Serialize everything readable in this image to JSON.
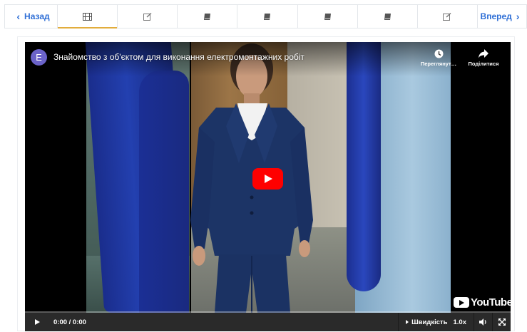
{
  "nav": {
    "prev_label": "Назад",
    "next_label": "Вперед",
    "tabs": [
      {
        "icon": "film-icon",
        "active": true
      },
      {
        "icon": "edit-icon",
        "active": false
      },
      {
        "icon": "book-icon",
        "active": false
      },
      {
        "icon": "book-icon",
        "active": false
      },
      {
        "icon": "book-icon",
        "active": false
      },
      {
        "icon": "book-icon",
        "active": false
      },
      {
        "icon": "edit-icon",
        "active": false
      }
    ],
    "accent_color": "#2f6fd6",
    "active_tab_underline": "#e2ad3c"
  },
  "video": {
    "channel_initial": "E",
    "title": "Знайомство з об'єктом для виконання електромонтажних робіт",
    "watch_later_label": "Переглянут…",
    "share_label": "Поділитися",
    "logo_text": "YouTube",
    "time": "0:00 / 0:00",
    "speed_label": "Швидкість",
    "speed_value": "1.0x",
    "progress": 0,
    "play_button_color": "#ff0000"
  }
}
